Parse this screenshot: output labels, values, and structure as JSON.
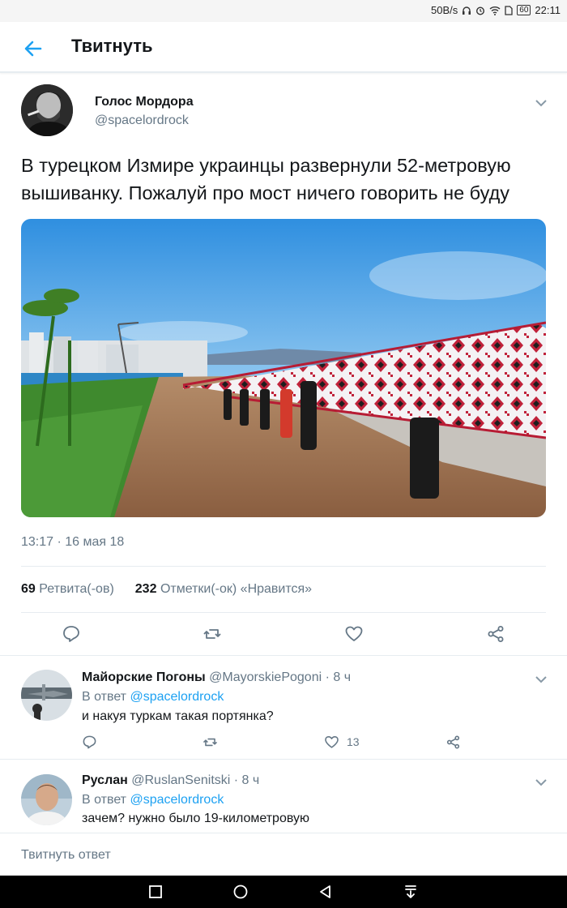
{
  "status_bar": {
    "speed": "50B/s",
    "battery": "60",
    "time": "22:11"
  },
  "app_bar": {
    "title": "Твитнуть"
  },
  "tweet": {
    "author_name": "Голос Мордора",
    "author_handle": "@spacelordrock",
    "text": "В турецком Измире украинцы развернули 52-метровую вышиванку. Пожалуй про мост ничего говорить не буду",
    "timestamp": "13:17 · 16 мая 18",
    "retweets_count": "69",
    "retweets_label": "Ретвита(-ов)",
    "likes_count": "232",
    "likes_label": "Отметки(-ок) «Нравится»"
  },
  "replies": [
    {
      "name": "Майорские Погоны",
      "handle": "@MayorskiePogoni",
      "time": "· 8 ч",
      "reply_to_prefix": "В ответ",
      "reply_to_handle": "@spacelordrock",
      "text": "и накуя туркам такая портянка?",
      "likes": "13"
    },
    {
      "name": "Руслан",
      "handle": "@RuslanSenitski",
      "time": "· 8 ч",
      "reply_to_prefix": "В ответ",
      "reply_to_handle": "@spacelordrock",
      "text": "зачем? нужно было 19-километровую"
    }
  ],
  "compose": {
    "placeholder": "Твитнуть ответ"
  },
  "colors": {
    "accent": "#1da1f2",
    "secondary_text": "#657786",
    "divider": "#e6ecf0"
  }
}
